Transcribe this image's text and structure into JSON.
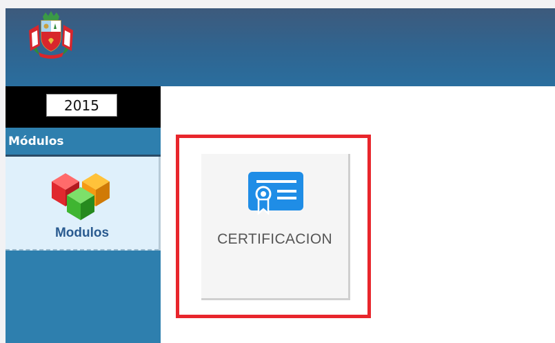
{
  "sidebar": {
    "year_value": "2015",
    "modules_heading": "Módulos",
    "module_item_label": "Modulos"
  },
  "main": {
    "tile_label": "CERTIFICACION"
  },
  "colors": {
    "header_top": "#3d5a7c",
    "header_bottom": "#2a6e9e",
    "sidebar": "#2e7fae",
    "module_item_bg": "#dff0fb",
    "module_label": "#2a5b90",
    "highlight_border": "#e8262c",
    "tile_bg": "#f5f5f5",
    "cert_icon": "#1f8de6"
  },
  "icons": {
    "crest": "coat-of-arms-icon",
    "modules": "cubes-icon",
    "certification": "certificate-icon"
  }
}
